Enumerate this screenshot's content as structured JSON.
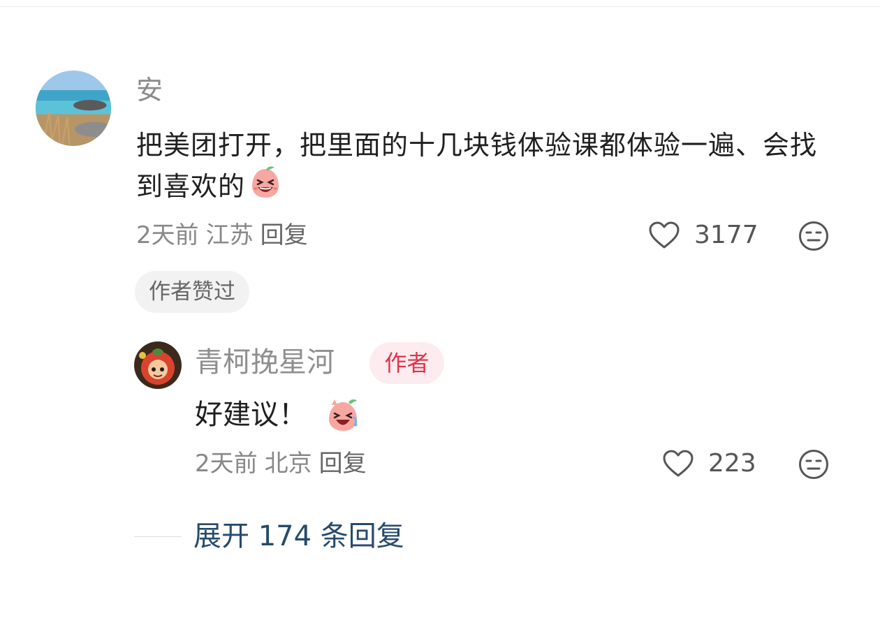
{
  "comment": {
    "username": "安",
    "text": "把美团打开，把里面的十几块钱体验课都体验一遍、会找到喜欢的",
    "emoji": "laughing-peach-emoji",
    "time": "2天前",
    "location": "江苏",
    "reply_label": "回复",
    "like_count": "3177",
    "author_liked_badge": "作者赞过"
  },
  "reply": {
    "username": "青柯挽星河",
    "author_badge": "作者",
    "text": "好建议！",
    "emoji": "laughing-tears-peach-emoji",
    "time": "2天前",
    "location": "北京",
    "reply_label": "回复",
    "like_count": "223"
  },
  "expand_replies": "展开 174 条回复",
  "colors": {
    "author_badge_text": "#e0334c",
    "author_badge_bg": "#fdecef",
    "expand_link": "#264a6b"
  }
}
